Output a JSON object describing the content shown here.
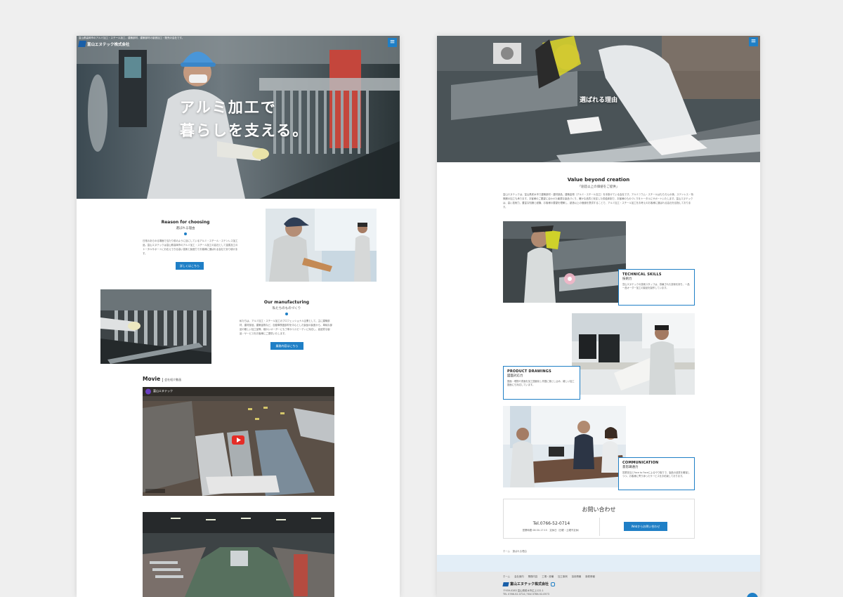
{
  "left_page": {
    "header_tagline": "富山県高岡市のアルミ加工・スチール加工、建築部材、建築部材の製造加工・販売の会社です。",
    "logo_text": "富山エヌテック株式会社",
    "hero_line1": "アルミ加工で",
    "hero_line2": "暮らしを支える。",
    "reason": {
      "title": "Reason for choosing",
      "subtitle": "選ばれる理由",
      "text": "日常のあらゆる場面で当たり前のように目にしているアルミ・スチール・ステンレス加工品。富山エヌテックは富山県高岡市のアルミ加工・スチール加工の会社として金属加工のトータルサポートにお応えできる高い技術と製造力でお客様に選ばれる会社であり続けます。",
      "button": "詳しくはこちら"
    },
    "manufacturing": {
      "title": "Our manufacturing",
      "subtitle": "私たちのものづくり",
      "text": "私たちは、アルミ加工・スチール加工のプロフェッショナル企業として、主に建築部材、建材部品、建築金物など、自動車関連部材を中心とした製品の製造から、単純な部品や難しい加工品等、細かいオーダーにも丁寧かつスピーディに対応し、高品質な製品・サービスをお客様にご提供いたします。",
      "button": "業務内容はこちら"
    },
    "movie": {
      "title": "Movie",
      "subtitle": "会社紹介動画",
      "channel": "富山エヌテック"
    }
  },
  "right_page": {
    "hero_label": "選ばれる理由",
    "value": {
      "title": "Value beyond creation",
      "subtitle": "「創造以上の価値をご提供」",
      "text": "富山エヌテックは、富山県射水市で建築部材・建材部品、建築金物（アルミ・スチール加工）を手掛けている会社です。アルミニウム・スチールはもちろんの事、ステンレス・特殊鋼の加工も承ります。お客様のご要望に合わせた最適な製品づくり、確かな品質と安定した供給体制で、お客様のものづくりをトータルにサポートいたします。富山エヌテックは、高い技術力、豊富な知識と経験、お客様の要望を理解し、創造以上の価値を提供することで、アルミ加工・スチール加工をお考えのお客様に選ばれる会社を目指しております。"
    },
    "skills": [
      {
        "title": "TECHNICAL SKILLS",
        "subtitle": "技術力",
        "text": "富山エヌテックの技術スタッフは、熟練された技術を持ち、一品一品オーダー加工の製品を製作しています。"
      },
      {
        "title": "PRODUCT DRAWINGS",
        "subtitle": "図面対応力",
        "text": "図面・現物や書面を加工図面化し作図に落とし込み、難しい加工図面にも対応しています。"
      },
      {
        "title": "COMMUNICATION",
        "subtitle": "意思疎通力",
        "text": "営業担当とFace to Faceによるやり取りで、製品の品質を確保しつつ、お客様に寄り添ったサービスをお約束しております。"
      }
    ],
    "contact": {
      "title": "お問い合わせ",
      "tel": "Tel.0766-52-0714",
      "hours": "営業時間 08:30-17:15　定休日（日曜・土曜不定休）",
      "button": "Webからお問い合わせ"
    },
    "breadcrumb": "ホーム　選ばれる理由",
    "footer": {
      "nav": [
        "ホーム",
        "会社案内",
        "業務内容",
        "工場・設備",
        "加工事例",
        "採用情報",
        "新着情報"
      ],
      "company": "富山エヌテック株式会社",
      "address": "〒939-0283 富山県射水市広上122-1",
      "tel_fax": "TEL 0766-52-0714 / FAX 0766-52-0573"
    }
  }
}
